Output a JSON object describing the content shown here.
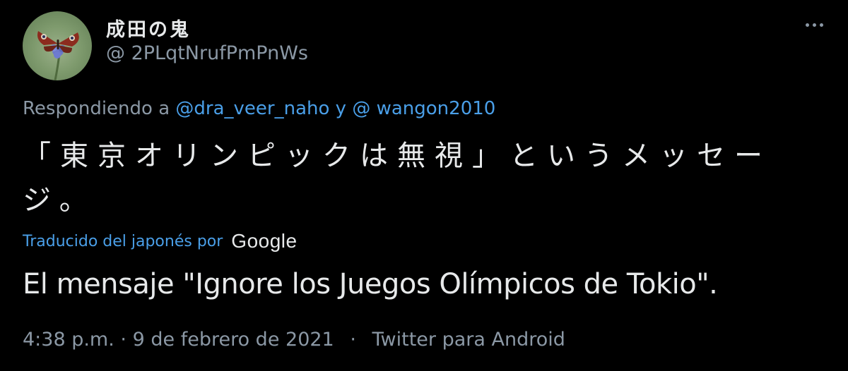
{
  "user": {
    "display_name": "成田の鬼",
    "handle": "@ 2PLqtNrufPmPnWs"
  },
  "reply": {
    "prefix": "Respondiendo a",
    "mention_1": "@dra_veer_naho",
    "conjunction": "y",
    "mention_2": "@ wangon2010"
  },
  "tweet": {
    "text": "「東京オリンピックは無視」というメッセージ。"
  },
  "translation": {
    "label": "Traducido del japonés por",
    "provider": "Google",
    "text": "El mensaje \"Ignore los Juegos Olímpicos de Tokio\"."
  },
  "meta": {
    "time": "4:38 p.m.",
    "separator_1": "·",
    "date": "9 de febrero de 2021",
    "separator_2": "·",
    "source": "Twitter para Android"
  },
  "colors": {
    "background": "#000000",
    "text": "#e7e9ea",
    "secondary": "#8b98a5",
    "link": "#4a9fe8"
  },
  "icons": {
    "more": "more-horizontal-icon",
    "avatar": "butterfly-avatar"
  }
}
